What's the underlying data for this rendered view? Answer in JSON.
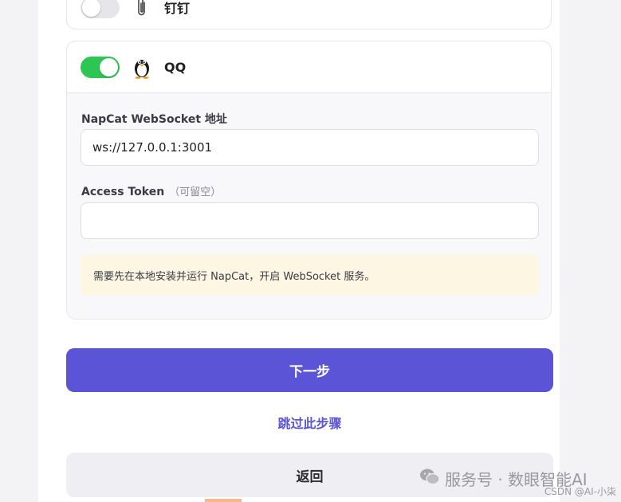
{
  "apps": {
    "dingtalk": {
      "name": "钉钉",
      "enabled": false,
      "icon": "paperclip-icon"
    },
    "qq": {
      "name": "QQ",
      "enabled": true,
      "icon": "penguin-icon"
    }
  },
  "qq_config": {
    "ws_label": "NapCat WebSocket 地址",
    "ws_value": "ws://127.0.0.1:3001",
    "token_label": "Access Token",
    "token_hint": "（可留空）",
    "token_value": "",
    "notice": "需要先在本地安装并运行 NapCat，开启 WebSocket 服务。"
  },
  "actions": {
    "next_label": "下一步",
    "skip_label": "跳过此步骤",
    "back_label": "返回"
  },
  "watermark": {
    "text": "服务号 · 数眼智能AI",
    "csdn": "CSDN @AI-小柒"
  },
  "colors": {
    "accent": "#5b54d6",
    "toggle_on": "#2dc653",
    "toggle_off": "#e5e5ea",
    "notice_bg": "#fdf6e3"
  }
}
